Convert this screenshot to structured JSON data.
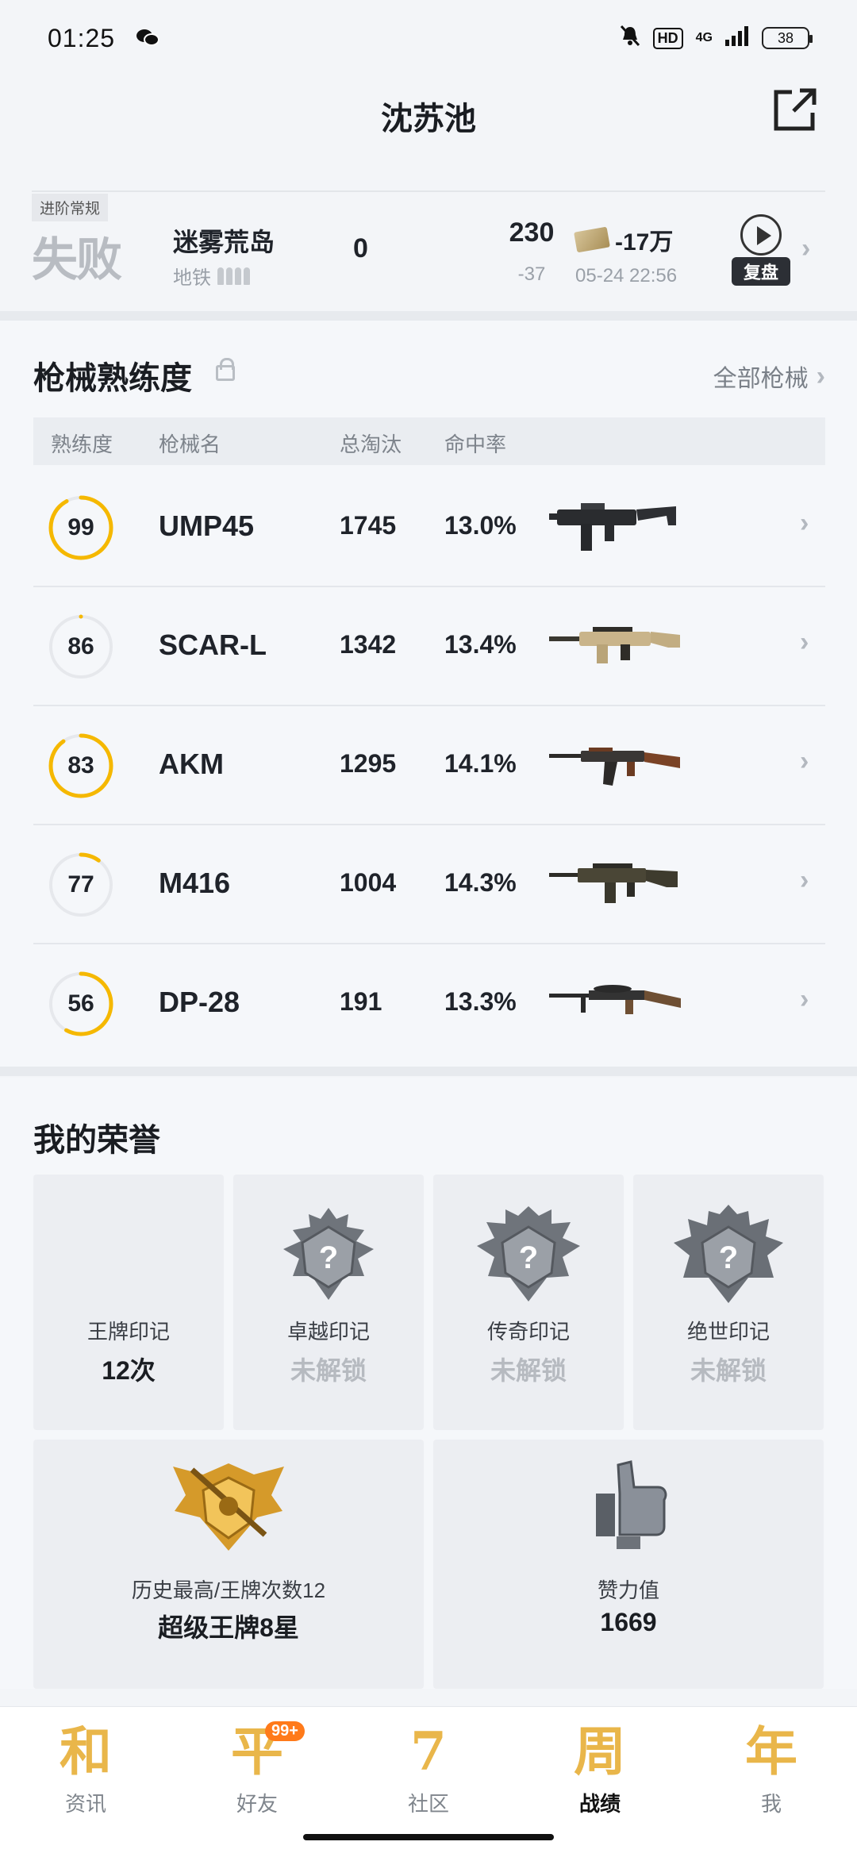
{
  "status_bar": {
    "time": "01:25",
    "hd": "HD",
    "network": "4G",
    "battery": "38"
  },
  "header": {
    "title": "沈苏池"
  },
  "match": {
    "mode": "进阶常规",
    "result": "失败",
    "map": "迷雾荒岛",
    "sub_mode": "地铁",
    "kills": "0",
    "rating": "230",
    "rating_delta": "-37",
    "money": "-17万",
    "date": "05-24 22:56",
    "replay_label": "复盘"
  },
  "weapons": {
    "title": "枪械熟练度",
    "all_link": "全部枪械",
    "headers": [
      "熟练度",
      "枪械名",
      "总淘汰",
      "命中率"
    ],
    "rows": [
      {
        "level": "99",
        "progress": 0.92,
        "name": "UMP45",
        "kills": "1745",
        "accuracy": "13.0%"
      },
      {
        "level": "86",
        "progress": 0.0,
        "name": "SCAR-L",
        "kills": "1342",
        "accuracy": "13.4%"
      },
      {
        "level": "83",
        "progress": 0.9,
        "name": "AKM",
        "kills": "1295",
        "accuracy": "14.1%"
      },
      {
        "level": "77",
        "progress": 0.1,
        "name": "M416",
        "kills": "1004",
        "accuracy": "14.3%"
      },
      {
        "level": "56",
        "progress": 0.58,
        "name": "DP-28",
        "kills": "191",
        "accuracy": "13.3%"
      }
    ]
  },
  "honors": {
    "title": "我的荣誉",
    "cards": [
      {
        "label": "王牌印记",
        "value": "12次"
      },
      {
        "label": "卓越印记",
        "value": "未解锁"
      },
      {
        "label": "传奇印记",
        "value": "未解锁"
      },
      {
        "label": "绝世印记",
        "value": "未解锁"
      }
    ],
    "wide_cards": [
      {
        "label": "历史最高/王牌次数12",
        "value": "超级王牌8星"
      },
      {
        "label": "赞力值",
        "value": "1669"
      }
    ]
  },
  "colors": {
    "accent": "#f5b800",
    "ring_track": "#e6e8ec",
    "locked": "#b6bac0"
  },
  "nav": {
    "items": [
      {
        "glyph": "和",
        "label": "资讯",
        "color": "#e9b64a"
      },
      {
        "glyph": "平",
        "label": "好友",
        "color": "#e9b64a",
        "badge": "99+"
      },
      {
        "glyph": "7",
        "label": "社区",
        "color": "#e9b64a"
      },
      {
        "glyph": "周",
        "label": "战绩",
        "color": "#e9b64a"
      },
      {
        "glyph": "年",
        "label": "我",
        "color": "#e9b64a"
      }
    ]
  }
}
